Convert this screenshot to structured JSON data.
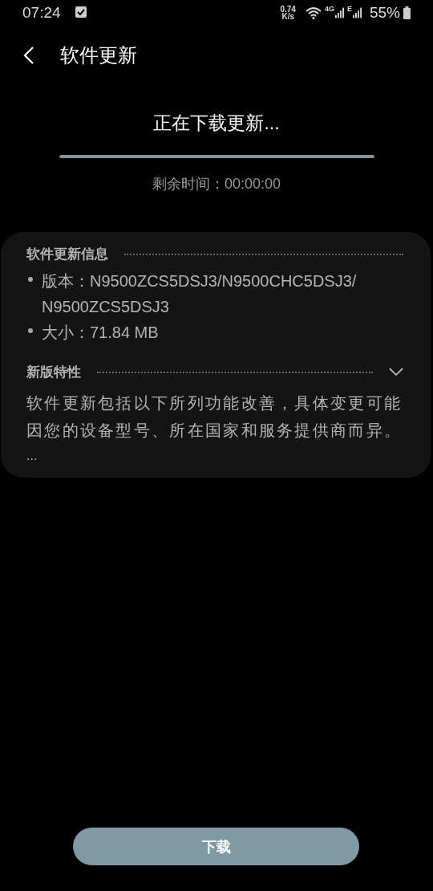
{
  "status_bar": {
    "time": "07:24",
    "speed_value": "0.74",
    "speed_unit": "K/s",
    "network_1": "4G",
    "network_2": "E",
    "battery": "55%"
  },
  "header": {
    "title": "软件更新"
  },
  "download": {
    "status": "正在下载更新...",
    "level": 1,
    "remaining": "剩余时间：00:00:00"
  },
  "info_card": {
    "heading": "软件更新信息",
    "items": [
      {
        "lines": [
          "版本：N9500ZCS5DSJ3/N9500CHC5DSJ3/",
          "N9500ZCS5DSJ3"
        ]
      },
      {
        "lines": [
          "大小：71.84 MB"
        ]
      }
    ],
    "features": {
      "heading": "新版特性",
      "expanded": false,
      "description": "软件更新包括以下所列功能改善，具体变更可能因您的设备型号、所在国家和服务提供商而异。",
      "more": "..."
    }
  },
  "button": {
    "label": "下载"
  }
}
